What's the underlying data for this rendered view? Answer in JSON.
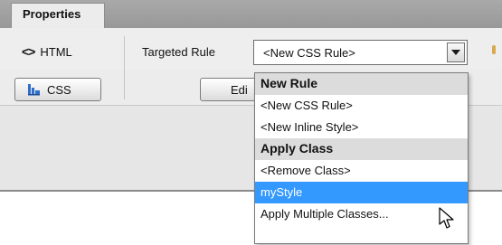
{
  "panel": {
    "tab_label": "Properties",
    "html_icon": "<>",
    "html_label": "HTML",
    "css_label": "CSS",
    "targeted_rule_label": "Targeted Rule",
    "targeted_rule_value": "<New CSS Rule>",
    "edit_label": "Edi"
  },
  "dropdown": {
    "items": [
      {
        "label": "New Rule",
        "kind": "header"
      },
      {
        "label": "<New CSS Rule>",
        "kind": "option"
      },
      {
        "label": "<New Inline Style>",
        "kind": "option"
      },
      {
        "label": "Apply Class",
        "kind": "header"
      },
      {
        "label": "<Remove Class>",
        "kind": "option"
      },
      {
        "label": "myStyle",
        "kind": "selected"
      },
      {
        "label": "Apply Multiple Classes...",
        "kind": "option"
      }
    ]
  },
  "icons": {
    "html": "angle-brackets-icon",
    "css": "css-blocks-icon",
    "dropdown_arrow": "chevron-down-icon",
    "cursor": "mouse-pointer-icon"
  },
  "colors": {
    "selection": "#3399ff",
    "css_icon": "#2f6fc9",
    "header_bg": "#dcdcdc"
  }
}
